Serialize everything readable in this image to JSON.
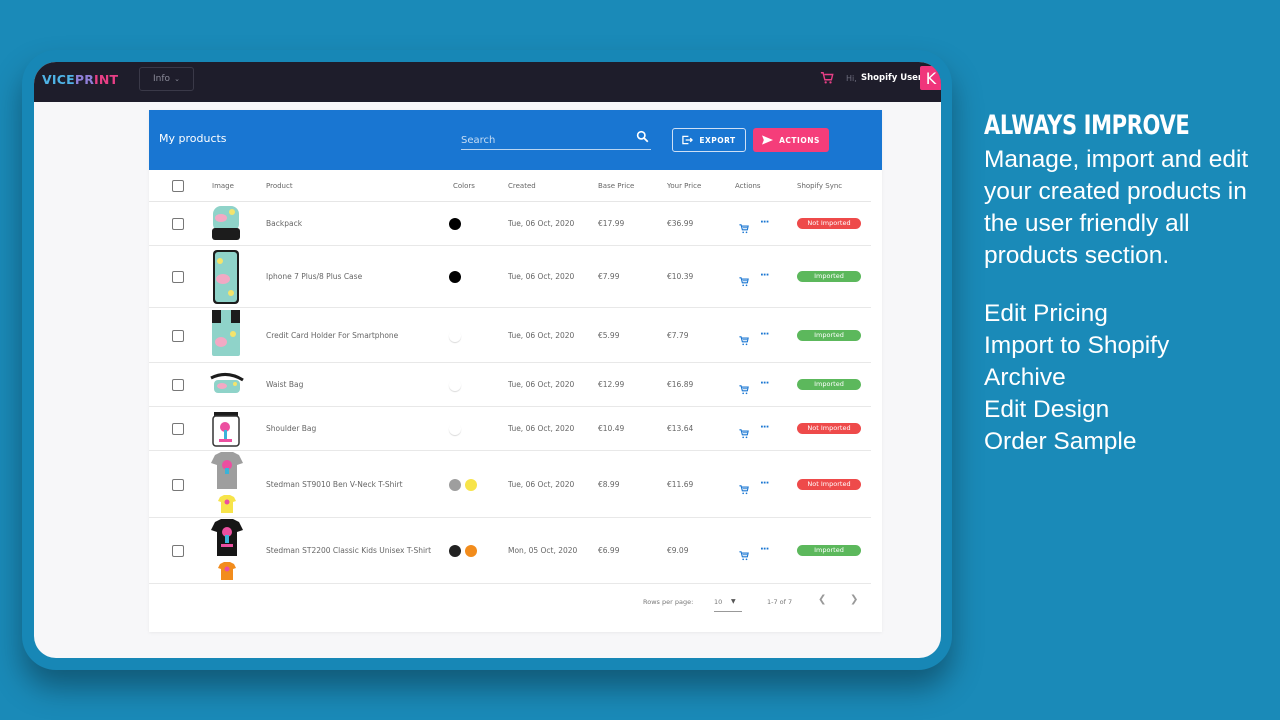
{
  "topbar": {
    "logo_parts": [
      "VICE",
      "PR",
      "INT"
    ],
    "info_label": "Info",
    "greeting": "Hi,",
    "username": "Shopify User",
    "avatar_letter": "K"
  },
  "products_card": {
    "title": "My products",
    "search_placeholder": "Search",
    "export_label": "EXPORT",
    "actions_label": "ACTIONS",
    "columns": [
      "Image",
      "Product",
      "Colors",
      "Created",
      "Base Price",
      "Your Price",
      "Actions",
      "Shopify Sync"
    ],
    "rows": [
      {
        "product": "Backpack",
        "colors": [
          "#000000"
        ],
        "created": "Tue, 06 Oct, 2020",
        "base_price": "€17.99",
        "your_price": "€36.99",
        "sync": "Not Imported",
        "sync_status": "red"
      },
      {
        "product": "Iphone 7 Plus/8 Plus Case",
        "colors": [
          "#000000"
        ],
        "created": "Tue, 06 Oct, 2020",
        "base_price": "€7.99",
        "your_price": "€10.39",
        "sync": "Imported",
        "sync_status": "green"
      },
      {
        "product": "Credit Card Holder For Smartphone",
        "colors": [
          "#ffffff"
        ],
        "created": "Tue, 06 Oct, 2020",
        "base_price": "€5.99",
        "your_price": "€7.79",
        "sync": "Imported",
        "sync_status": "green"
      },
      {
        "product": "Waist Bag",
        "colors": [
          "#ffffff"
        ],
        "created": "Tue, 06 Oct, 2020",
        "base_price": "€12.99",
        "your_price": "€16.89",
        "sync": "Imported",
        "sync_status": "green"
      },
      {
        "product": "Shoulder Bag",
        "colors": [
          "#ffffff"
        ],
        "created": "Tue, 06 Oct, 2020",
        "base_price": "€10.49",
        "your_price": "€13.64",
        "sync": "Not Imported",
        "sync_status": "red"
      },
      {
        "product": "Stedman ST9010 Ben V-Neck T-Shirt",
        "colors": [
          "#9e9e9e",
          "#f7e44a"
        ],
        "created": "Tue, 06 Oct, 2020",
        "base_price": "€8.99",
        "your_price": "€11.69",
        "sync": "Not Imported",
        "sync_status": "red"
      },
      {
        "product": "Stedman ST2200 Classic Kids Unisex T-Shirt",
        "colors": [
          "#222222",
          "#f28c1c"
        ],
        "created": "Mon, 05 Oct, 2020",
        "base_price": "€6.99",
        "your_price": "€9.09",
        "sync": "Imported",
        "sync_status": "green"
      }
    ],
    "pagination": {
      "rows_per_page_label": "Rows per page:",
      "rows_per_page": "10",
      "range": "1-7 of 7"
    }
  },
  "marketing": {
    "headline": "ALWAYS IMPROVE",
    "description": "Manage, import and edit your created products in the user friendly all products section.",
    "features": [
      "Edit Pricing",
      "Import to Shopify",
      "Archive",
      "Edit Design",
      "Order Sample"
    ]
  },
  "colors": {
    "background": "#1a8ab8",
    "header_blue": "#1976d2",
    "actions_pink": "#f53d7a",
    "imported_green": "#5cb85c",
    "not_imported_red": "#ee4a4a",
    "topbar_dark": "#1e1d2b"
  }
}
